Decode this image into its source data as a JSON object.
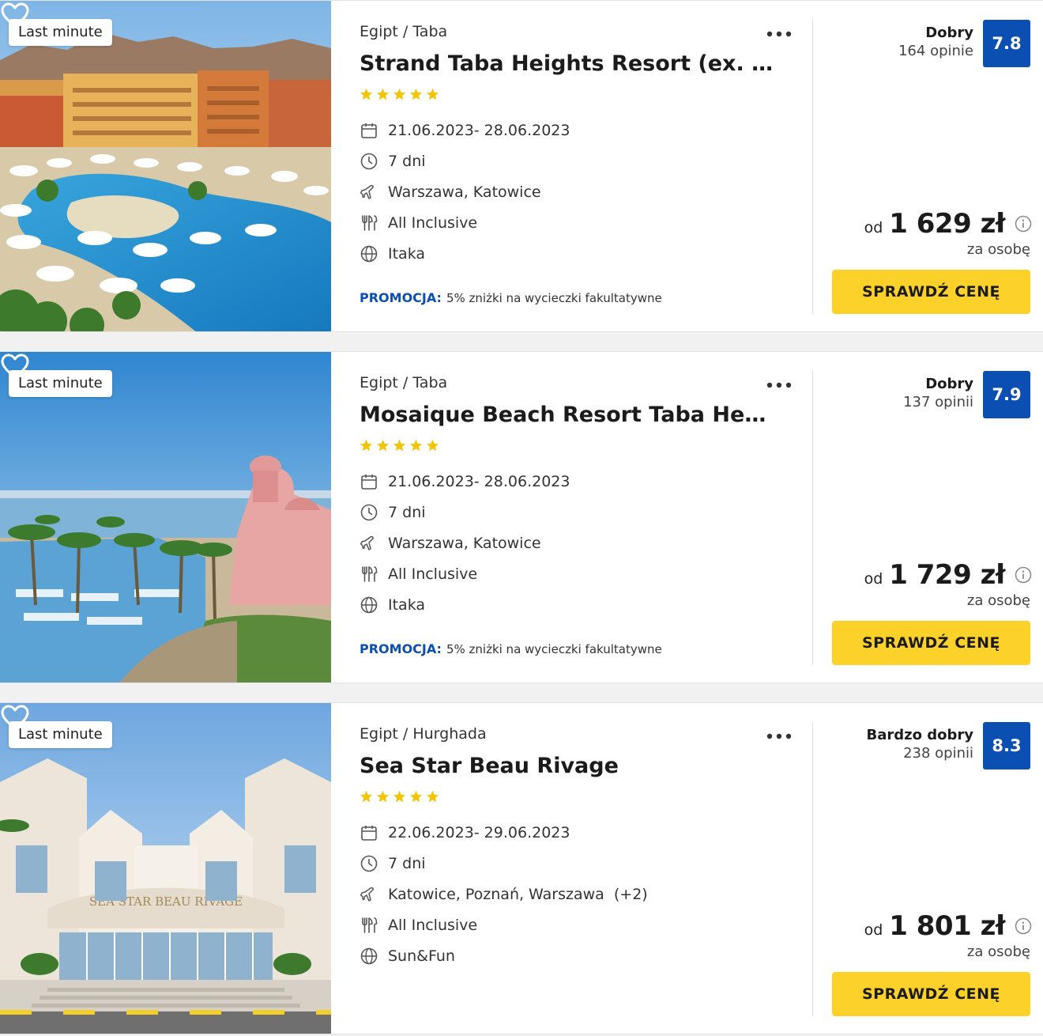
{
  "offers": [
    {
      "badge": "Last minute",
      "country": "Egipt",
      "region": "Taba",
      "name": "Strand Taba Heights Resort (ex. InterContinental Taba Heights)",
      "stars": 5,
      "dates": "21.06.2023- 28.06.2023",
      "duration": "7 dni",
      "departure": "Warszawa, Katowice",
      "board": "All Inclusive",
      "operator": "Itaka",
      "promo_label": "PROMOCJA:",
      "promo_text": "5% zniżki na wycieczki fakultatywne",
      "rating_text": "Dobry",
      "reviews": "164 opinie",
      "score": "7.8",
      "price_prefix": "od",
      "price": "1 629 zł",
      "price_note": "za osobę",
      "cta": "SPRAWDŹ CENĘ",
      "photo": "pool-resort"
    },
    {
      "badge": "Last minute",
      "country": "Egipt",
      "region": "Taba",
      "name": "Mosaique Beach Resort Taba Heights",
      "stars": 5,
      "dates": "21.06.2023- 28.06.2023",
      "duration": "7 dni",
      "departure": "Warszawa, Katowice",
      "board": "All Inclusive",
      "operator": "Itaka",
      "promo_label": "PROMOCJA:",
      "promo_text": "5% zniżki na wycieczki fakultatywne",
      "rating_text": "Dobry",
      "reviews": "137 opinii",
      "score": "7.9",
      "price_prefix": "od",
      "price": "1 729 zł",
      "price_note": "za osobę",
      "cta": "SPRAWDŹ CENĘ",
      "photo": "beach-palms"
    },
    {
      "badge": "Last minute",
      "country": "Egipt",
      "region": "Hurghada",
      "name": "Sea Star Beau Rivage",
      "stars": 5,
      "dates": "22.06.2023- 29.06.2023",
      "duration": "7 dni",
      "departure": "Katowice, Poznań, Warszawa  (+2)",
      "board": "All Inclusive",
      "operator": "Sun&Fun",
      "promo_label": "",
      "promo_text": "",
      "rating_text": "Bardzo dobry",
      "reviews": "238 opinii",
      "score": "8.3",
      "price_prefix": "od",
      "price": "1 801 zł",
      "price_note": "za osobę",
      "cta": "SPRAWDŹ CENĘ",
      "photo": "hotel-facade",
      "photo_sign": "SEA STAR BEAU RIVAGE"
    }
  ],
  "icons": {
    "favorite": "heart-outline-icon",
    "menu": "more-dots-icon",
    "dates": "calendar-icon",
    "duration": "clock-icon",
    "departure": "plane-icon",
    "board": "cutlery-icon",
    "operator": "globe-icon",
    "price_info": "info-icon"
  },
  "colors": {
    "accent": "#0b4fb3",
    "cta": "#fcd12a",
    "star": "#f5c400"
  }
}
